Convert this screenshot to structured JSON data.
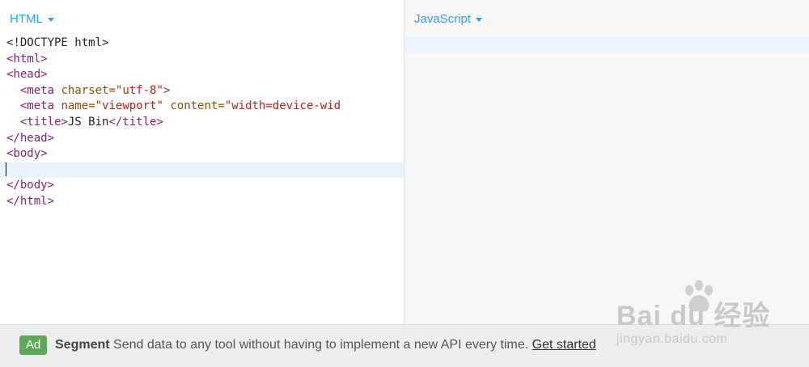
{
  "editor": {
    "html_panel": {
      "label": "HTML",
      "code_lines": [
        "<!DOCTYPE html>",
        "<html>",
        "<head>",
        "  <meta charset=\"utf-8\">",
        "  <meta name=\"viewport\" content=\"width=device-wid",
        "  <title>JS Bin</title>",
        "</head>",
        "<body>",
        "",
        "</body>",
        "</html>"
      ],
      "tokens": {
        "doctype": "<!DOCTYPE html>",
        "html_open": "<html>",
        "head_open": "<head>",
        "meta_open": "<meta",
        "charset_attr": "charset=",
        "charset_val": "\"utf-8\"",
        "tag_close": ">",
        "name_attr": "name=",
        "name_val": "\"viewport\"",
        "content_attr": "content=",
        "content_val": "\"width=device-wid",
        "title_open": "<title>",
        "title_text": "JS Bin",
        "title_close": "</title>",
        "head_close": "</head>",
        "body_open": "<body>",
        "body_close": "</body>",
        "html_close": "</html>"
      }
    },
    "js_panel": {
      "label": "JavaScript"
    }
  },
  "ad": {
    "badge": "Ad",
    "brand": "Segment",
    "text": "Send data to any tool without having to implement a new API every time.",
    "link": "Get started"
  },
  "watermark": {
    "logo": "Bai du 经验",
    "url": "jingyan.baidu.com"
  },
  "colors": {
    "accent": "#2f9ef5",
    "tag": "#80247a",
    "attr": "#8a4f06",
    "string": "#b3251a",
    "active_line": "#eaf2fd",
    "ad_badge": "#5fa85a"
  },
  "icons": {
    "dropdown": "chevron-down-icon",
    "watermark": "paw-icon"
  }
}
